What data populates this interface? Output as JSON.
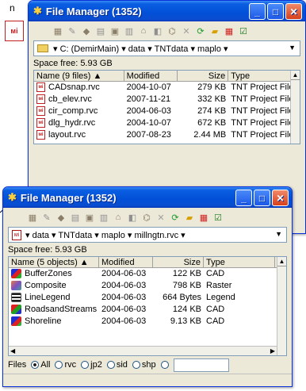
{
  "callout_text": "n",
  "bigicon_text": "мі",
  "back_window": {
    "title": "File Manager (1352)",
    "path": "▾ C: (DemirMain) ▾ data ▾ TNTdata ▾ maplo ▾",
    "space": "Space free: 5.93 GB",
    "headers": [
      "Name (9 files) ▲",
      "Modified",
      "Size",
      "Type"
    ],
    "rows": [
      {
        "name": "CADsnap.rvc",
        "modified": "2004-10-07",
        "size": "279 KB",
        "type": "TNT Project File"
      },
      {
        "name": "cb_elev.rvc",
        "modified": "2007-11-21",
        "size": "332 KB",
        "type": "TNT Project File"
      },
      {
        "name": "cir_comp.rvc",
        "modified": "2004-06-03",
        "size": "274 KB",
        "type": "TNT Project File"
      },
      {
        "name": "dlg_hydr.rvc",
        "modified": "2004-10-07",
        "size": "672 KB",
        "type": "TNT Project File"
      },
      {
        "name": "layout.rvc",
        "modified": "2007-08-23",
        "size": "2.44 MB",
        "type": "TNT Project File"
      }
    ]
  },
  "front_window": {
    "title": "File Manager (1352)",
    "path": "▾ data ▾ TNTdata ▾ maplo ▾ millngtn.rvc ▾",
    "space": "Space free: 5.93 GB",
    "headers": [
      "Name (5 objects) ▲",
      "Modified",
      "Size",
      "Type"
    ],
    "rows": [
      {
        "name": "BufferZones",
        "modified": "2004-06-03",
        "size": "122 KB",
        "type": "CAD",
        "icon": "buffer"
      },
      {
        "name": "Composite",
        "modified": "2004-06-03",
        "size": "798 KB",
        "type": "Raster",
        "icon": "composite"
      },
      {
        "name": "LineLegend",
        "modified": "2004-06-03",
        "size": "664 Bytes",
        "type": "Legend",
        "icon": "legend"
      },
      {
        "name": "RoadsandStreams",
        "modified": "2004-06-03",
        "size": "124 KB",
        "type": "CAD",
        "icon": "roads"
      },
      {
        "name": "Shoreline",
        "modified": "2004-06-03",
        "size": "9.13 KB",
        "type": "CAD",
        "icon": "shore"
      }
    ],
    "files_label": "Files",
    "filters": [
      {
        "label": "All",
        "selected": true
      },
      {
        "label": "rvc",
        "selected": false
      },
      {
        "label": "jp2",
        "selected": false
      },
      {
        "label": "sid",
        "selected": false
      },
      {
        "label": "shp",
        "selected": false
      },
      {
        "label": "",
        "selected": false
      }
    ]
  },
  "icons": {
    "title": "tnt-app-icon",
    "minimize": "_",
    "maximize": "□",
    "close": "✕"
  }
}
